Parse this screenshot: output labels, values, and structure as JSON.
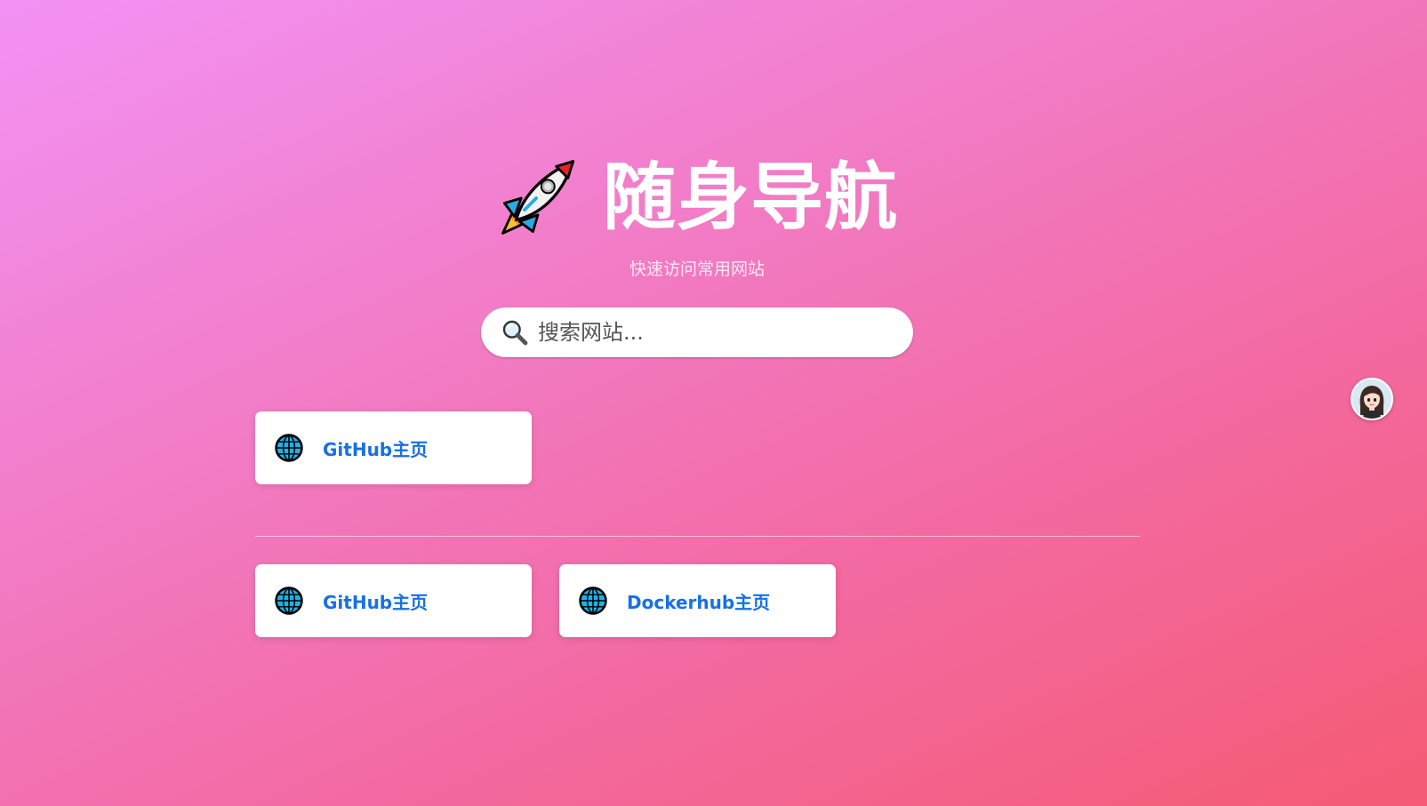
{
  "header": {
    "title": "随身导航",
    "subtitle": "快速访问常用网站",
    "icon": "rocket-icon"
  },
  "search": {
    "placeholder": "搜索网站...",
    "value": "",
    "icon": "search-icon"
  },
  "groups": [
    {
      "links": [
        {
          "label": "GitHub主页",
          "icon": "globe-icon"
        }
      ]
    },
    {
      "links": [
        {
          "label": "GitHub主页",
          "icon": "globe-icon"
        },
        {
          "label": "Dockerhub主页",
          "icon": "globe-icon"
        }
      ]
    }
  ],
  "avatar": {
    "icon": "avatar"
  },
  "colors": {
    "gradient_start": "#f392f5",
    "gradient_end": "#f55b74",
    "link_text": "#1670e6",
    "card_bg": "#ffffff"
  }
}
